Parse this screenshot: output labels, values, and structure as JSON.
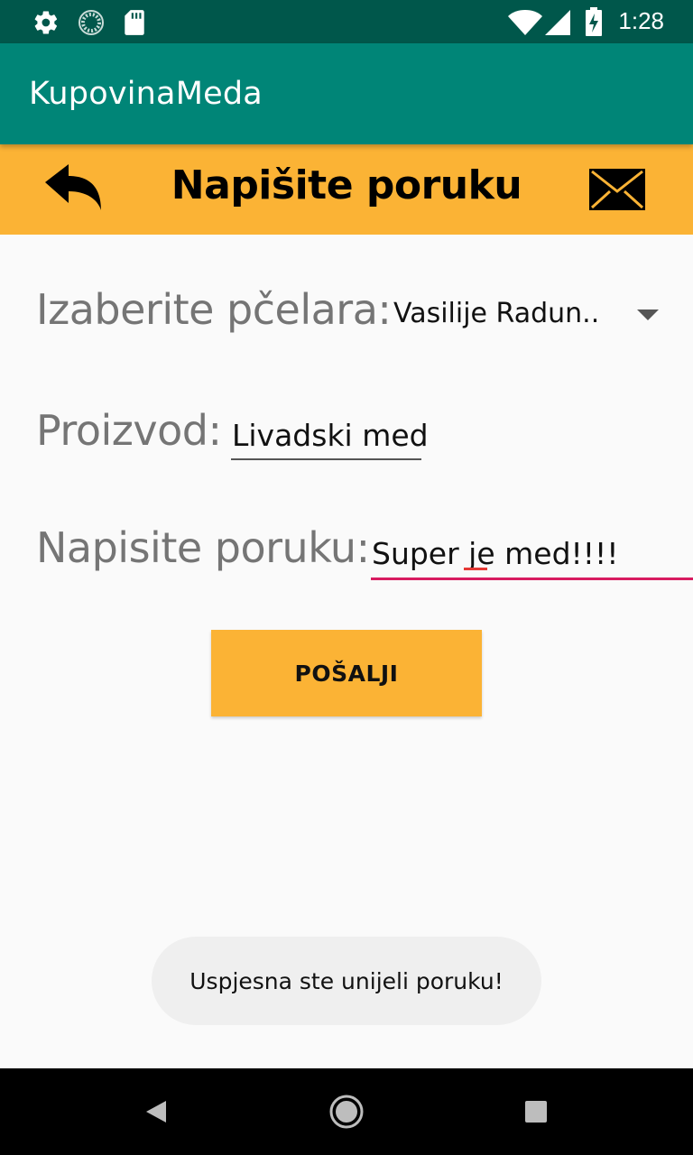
{
  "status_bar": {
    "time": "1:28",
    "icons": [
      "gear-icon",
      "sync-icon",
      "sd-card-icon",
      "wifi-icon",
      "signal-icon",
      "battery-charging-icon"
    ]
  },
  "app_bar": {
    "title": "KupovinaMeda"
  },
  "header": {
    "title": "Napišite poruku",
    "back_icon": "reply-arrow-icon",
    "mail_icon": "envelope-icon"
  },
  "form": {
    "beekeeper": {
      "label": "Izaberite pčelara:",
      "selected": "Vasilije Radun.."
    },
    "product": {
      "label": "Proizvod:",
      "value": "Livadski med"
    },
    "message": {
      "label": "Napisite poruku:",
      "value": "Super je med!!!!"
    },
    "send_label": "POŠALJI"
  },
  "toast": {
    "text": "Uspjesna ste unijeli poruku!"
  },
  "nav_bar": {
    "icons": [
      "back-triangle-icon",
      "home-circle-icon",
      "recents-square-icon"
    ]
  },
  "colors": {
    "status_bar": "#00574b",
    "app_bar": "#008577",
    "accent_amber": "#fbb335",
    "active_underline": "#d81b60"
  }
}
